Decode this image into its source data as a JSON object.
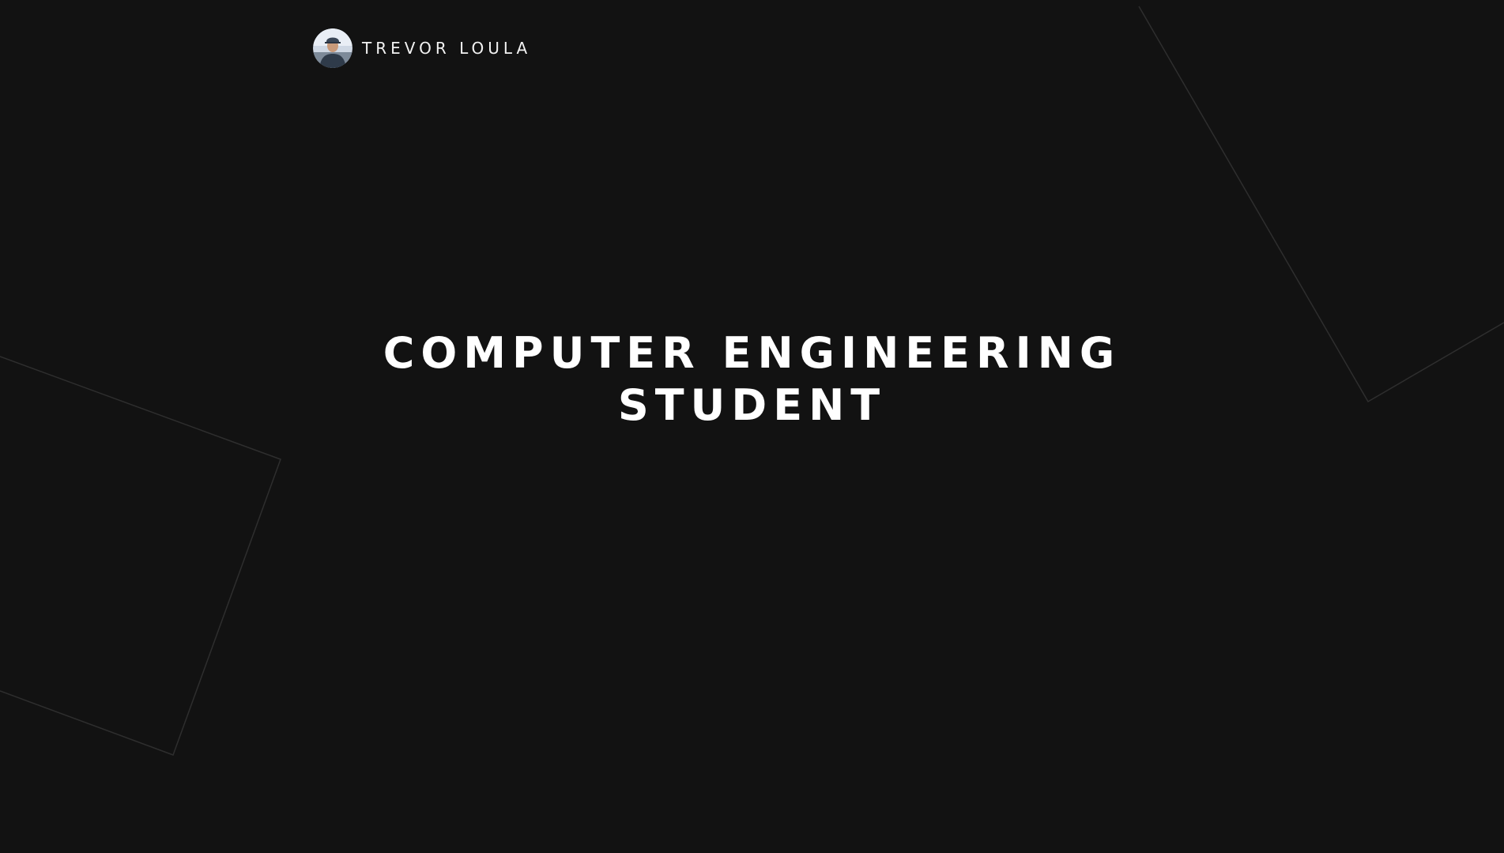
{
  "header": {
    "name": "TREVOR LOULA",
    "avatar_icon": "profile-photo"
  },
  "hero": {
    "title_line1": "COMPUTER ENGINEERING",
    "title_line2": "STUDENT"
  },
  "colors": {
    "background": "#121212",
    "text": "#ffffff",
    "decorative_lines": "#2e2e2e"
  }
}
